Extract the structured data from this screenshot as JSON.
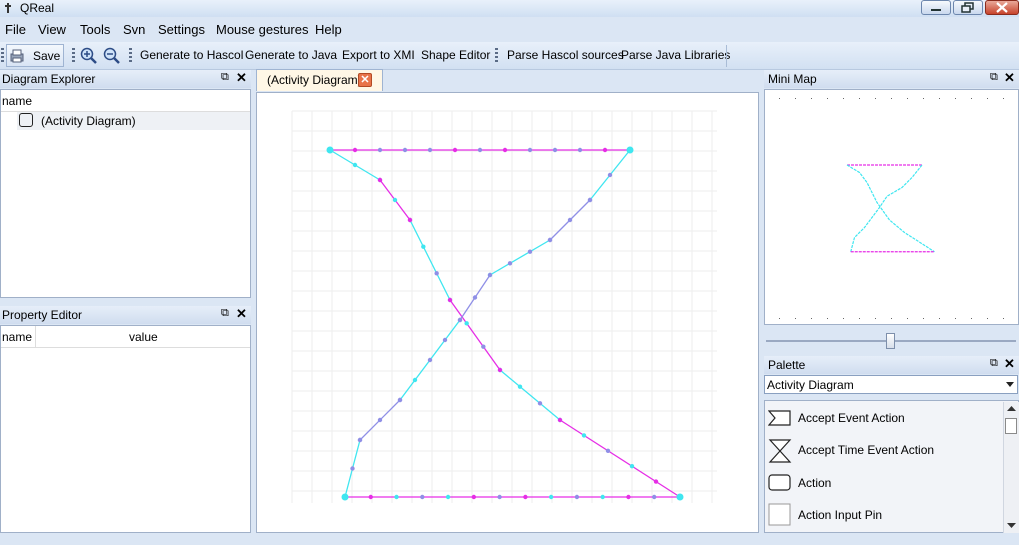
{
  "window": {
    "title": "QReal"
  },
  "menu": [
    "File",
    "View",
    "Tools",
    "Svn",
    "Settings",
    "Mouse gestures",
    "Help"
  ],
  "toolbar": {
    "save_label": "Save",
    "generate_hascol": "Generate to Hascol",
    "generate_java": "Generate to Java",
    "export_xmi": "Export to XMI",
    "shape_editor": "Shape Editor",
    "parse_hascol": "Parse Hascol sources",
    "parse_java": "Parse Java Libraries"
  },
  "diagram_explorer": {
    "title": "Diagram Explorer",
    "column": "name",
    "items": [
      "(Activity Diagram)"
    ]
  },
  "property_editor": {
    "title": "Property Editor",
    "col_name": "name",
    "col_value": "value"
  },
  "tab": {
    "label": "(Activity Diagram)"
  },
  "minimap": {
    "title": "Mini Map"
  },
  "palette": {
    "title": "Palette",
    "selected": "Activity Diagram",
    "items": [
      "Accept Event Action",
      "Accept Time Event Action",
      "Action",
      "Action Input Pin"
    ]
  },
  "colors": {
    "cyan": "#3fe6f0",
    "magenta": "#e62ee6",
    "violet": "#8f8fe6"
  }
}
